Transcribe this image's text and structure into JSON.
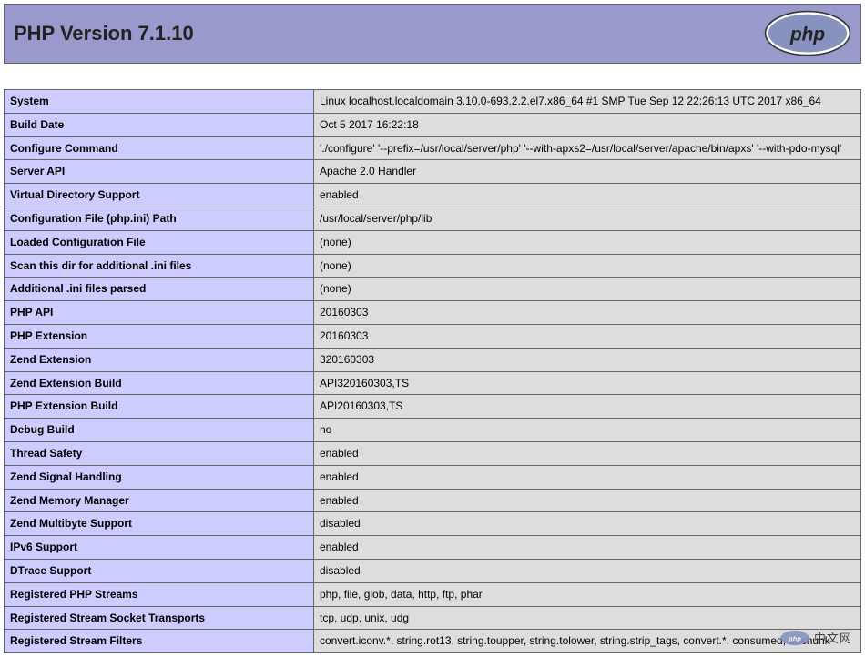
{
  "header": {
    "title": "PHP Version 7.1.10"
  },
  "rows": [
    {
      "label": "System",
      "value": "Linux localhost.localdomain 3.10.0-693.2.2.el7.x86_64 #1 SMP Tue Sep 12 22:26:13 UTC 2017 x86_64"
    },
    {
      "label": "Build Date",
      "value": "Oct 5 2017 16:22:18"
    },
    {
      "label": "Configure Command",
      "value": "'./configure' '--prefix=/usr/local/server/php' '--with-apxs2=/usr/local/server/apache/bin/apxs' '--with-pdo-mysql'"
    },
    {
      "label": "Server API",
      "value": "Apache 2.0 Handler"
    },
    {
      "label": "Virtual Directory Support",
      "value": "enabled"
    },
    {
      "label": "Configuration File (php.ini) Path",
      "value": "/usr/local/server/php/lib"
    },
    {
      "label": "Loaded Configuration File",
      "value": "(none)"
    },
    {
      "label": "Scan this dir for additional .ini files",
      "value": "(none)"
    },
    {
      "label": "Additional .ini files parsed",
      "value": "(none)"
    },
    {
      "label": "PHP API",
      "value": "20160303"
    },
    {
      "label": "PHP Extension",
      "value": "20160303"
    },
    {
      "label": "Zend Extension",
      "value": "320160303"
    },
    {
      "label": "Zend Extension Build",
      "value": "API320160303,TS"
    },
    {
      "label": "PHP Extension Build",
      "value": "API20160303,TS"
    },
    {
      "label": "Debug Build",
      "value": "no"
    },
    {
      "label": "Thread Safety",
      "value": "enabled"
    },
    {
      "label": "Zend Signal Handling",
      "value": "enabled"
    },
    {
      "label": "Zend Memory Manager",
      "value": "enabled"
    },
    {
      "label": "Zend Multibyte Support",
      "value": "disabled"
    },
    {
      "label": "IPv6 Support",
      "value": "enabled"
    },
    {
      "label": "DTrace Support",
      "value": "disabled"
    },
    {
      "label": "Registered PHP Streams",
      "value": "php, file, glob, data, http, ftp, phar"
    },
    {
      "label": "Registered Stream Socket Transports",
      "value": "tcp, udp, unix, udg"
    },
    {
      "label": "Registered Stream Filters",
      "value": "convert.iconv.*, string.rot13, string.toupper, string.tolower, string.strip_tags, convert.*, consumed, dechunk"
    }
  ],
  "watermark": {
    "text": "中文网"
  }
}
